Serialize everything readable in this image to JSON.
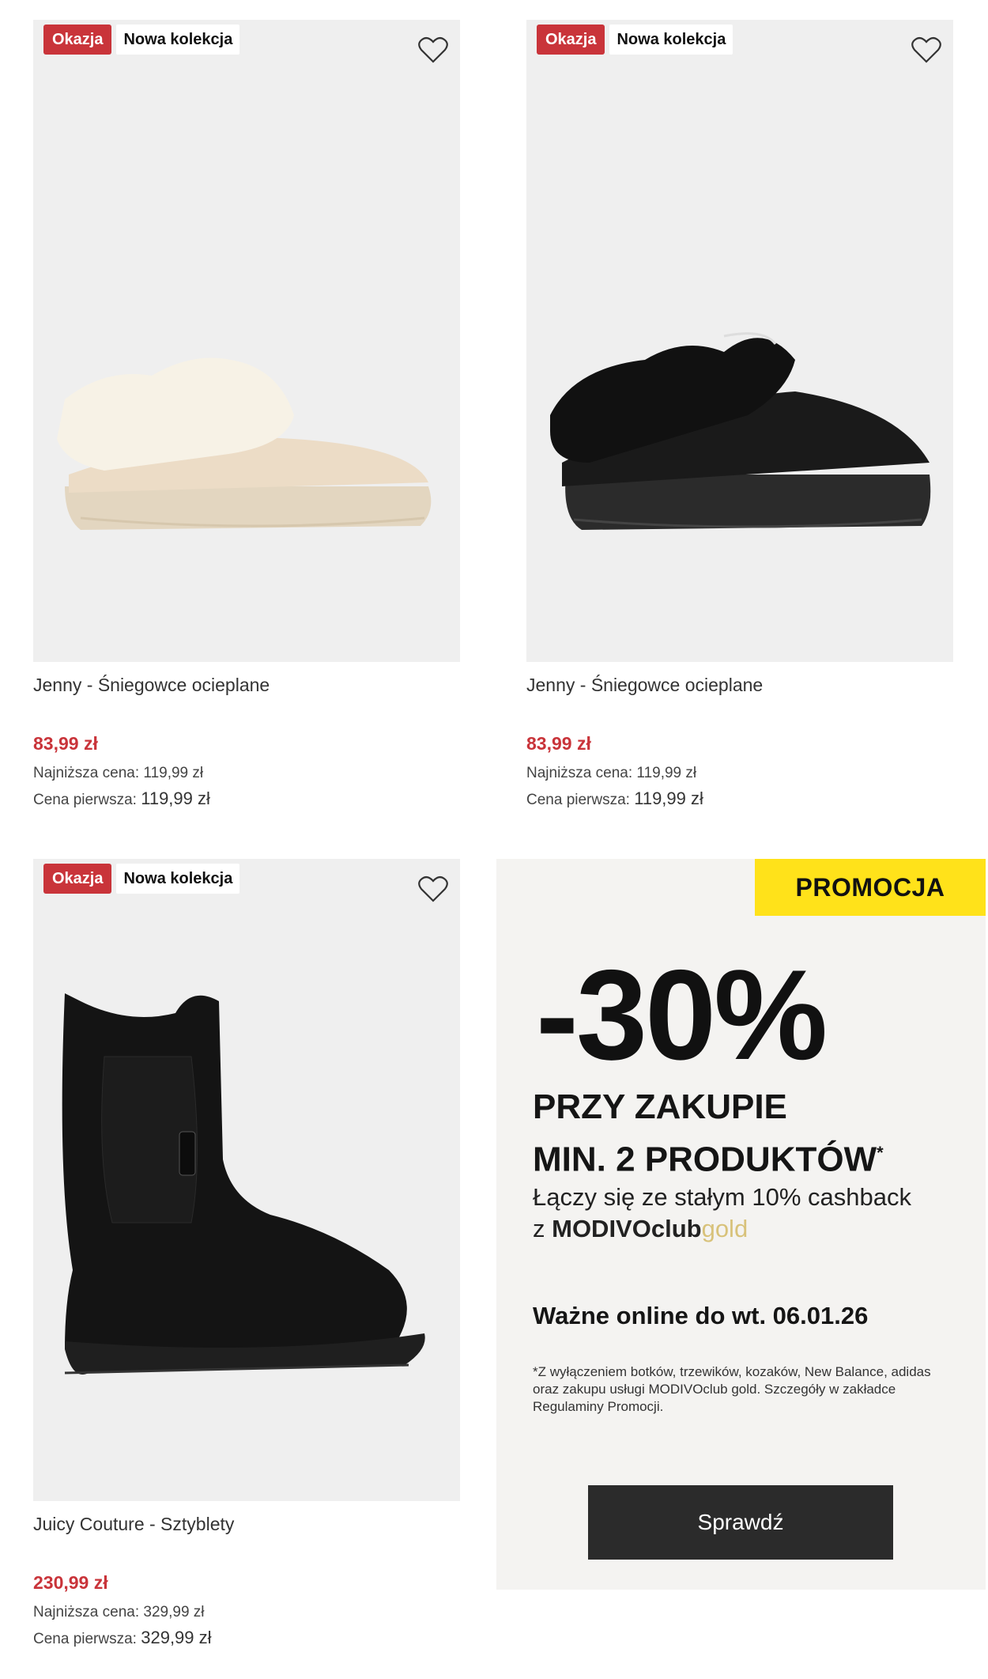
{
  "products": [
    {
      "badge_sale": "Okazja",
      "badge_new": "Nowa kolekcja",
      "name": "Jenny - Śniegowce ocieplane",
      "price": "83,99 zł",
      "lowest_label": "Najniższa cena:",
      "lowest_price": "119,99 zł",
      "first_label": "Cena pierwsza:",
      "first_price": "119,99 zł",
      "image": "beige-fur-platform-slipper",
      "favorite_icon": "heart-icon"
    },
    {
      "badge_sale": "Okazja",
      "badge_new": "Nowa kolekcja",
      "name": "Jenny - Śniegowce ocieplane",
      "price": "83,99 zł",
      "lowest_label": "Najniższa cena:",
      "lowest_price": "119,99 zł",
      "first_label": "Cena pierwsza:",
      "first_price": "119,99 zł",
      "image": "black-fur-platform-slipper",
      "favorite_icon": "heart-icon"
    },
    {
      "badge_sale": "Okazja",
      "badge_new": "Nowa kolekcja",
      "name": "Juicy Couture - Sztyblety",
      "price": "230,99 zł",
      "lowest_label": "Najniższa cena:",
      "lowest_price": "329,99 zł",
      "first_label": "Cena pierwsza:",
      "first_price": "329,99 zł",
      "image": "black-chelsea-boot",
      "favorite_icon": "heart-icon"
    }
  ],
  "promo": {
    "tag": "PROMOCJA",
    "discount": "-30%",
    "headline_line1": "PRZY ZAKUPIE",
    "headline_line2": "MIN. 2 PRODUKTÓW",
    "headline_mark": "*",
    "cashback_line1": "Łączy się ze stałym 10% cashback",
    "cashback_prefix": "z",
    "club_name": "MODIVOclub",
    "club_tier": "gold",
    "validity": "Ważne online do wt. 06.01.26",
    "fine_print": "*Z wyłączeniem botków, trzewików, kozaków, New Balance, adidas oraz zakupu usługi MODIVOclub gold. Szczegóły w zakładce Regulaminy Promocji.",
    "cta": "Sprawdź",
    "colors": {
      "tag_bg": "#ffe21a",
      "cta_bg": "#2b2b2b",
      "gold": "#d8c27a"
    }
  },
  "colors": {
    "sale_red": "#c9343a",
    "image_bg": "#efefef",
    "promo_bg": "#f4f3f1"
  }
}
